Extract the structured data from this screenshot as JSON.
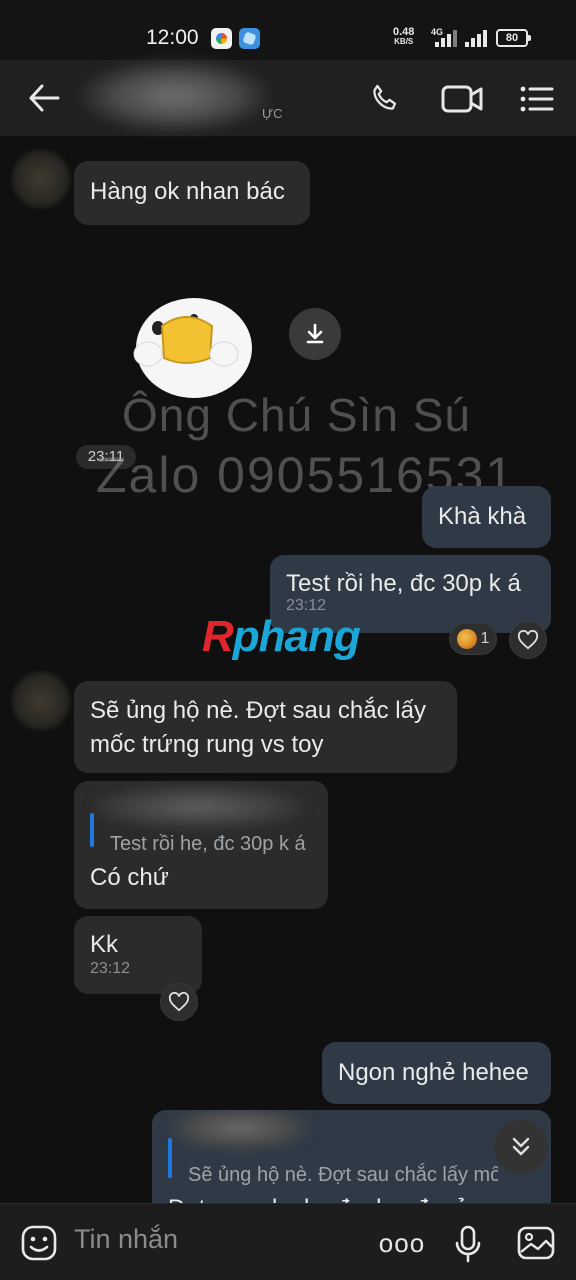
{
  "status_bar": {
    "time": "12:00",
    "speed_value": "0.48",
    "speed_unit": "KB/S",
    "network": "4G",
    "battery": "80"
  },
  "header": {
    "contact_subtitle": "ỰC",
    "icons": [
      "back-arrow-icon",
      "phone-icon",
      "video-call-icon",
      "menu-list-icon"
    ]
  },
  "messages": {
    "m1": {
      "text": "Hàng ok nhan bác"
    },
    "sticker": {
      "time": "23:11"
    },
    "m2": {
      "text": "Khà khà"
    },
    "m3": {
      "text": "Test rồi he, đc 30p k á",
      "time": "23:12",
      "reaction_count": "1"
    },
    "m4": {
      "text": "Sẽ ủng hộ nè. Đợt sau chắc lấy mốc trứng rung vs toy"
    },
    "m5": {
      "quote": "Test rồi he, đc 30p k á",
      "text": "Có chứ"
    },
    "m6": {
      "text": "Kk",
      "time": "23:12"
    },
    "m7": {
      "text": "Ngon nghẻ hehee"
    },
    "m8": {
      "quote": "Sẽ ủng hộ nè. Đợt sau chắc lấy mốc",
      "partial": "Dat... n... l... l... đ... k... đ... ả..."
    }
  },
  "watermark": {
    "line1": "Ông Chú Sìn Sú",
    "line2": "Zalo 0905516531",
    "brand_r": "R",
    "brand_rest": "phang"
  },
  "composer": {
    "placeholder": "Tin nhắn",
    "more_label": "ooo"
  },
  "colors": {
    "background": "#101010",
    "incoming_bubble": "#2b2b2b",
    "outgoing_bubble": "#2f3a46",
    "accent": "#1f7ae0"
  }
}
